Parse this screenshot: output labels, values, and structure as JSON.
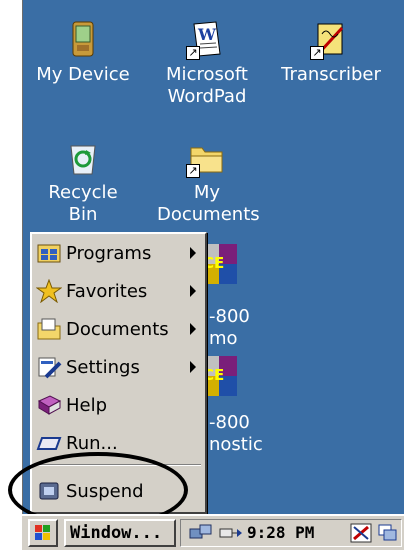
{
  "desktop": {
    "icons": [
      {
        "label": "My Device"
      },
      {
        "label": "Microsoft WordPad"
      },
      {
        "label": "Transcriber"
      },
      {
        "label": "Recycle Bin"
      },
      {
        "label": "My Documents"
      }
    ],
    "partial_labels": {
      "app1_line1": "-800",
      "app1_line2": "mo",
      "app2_line1": "-800",
      "app2_line2": "nostic",
      "wce_text": "CE"
    }
  },
  "start_menu": {
    "items": [
      {
        "label": "Programs",
        "submenu": true
      },
      {
        "label": "Favorites",
        "submenu": true
      },
      {
        "label": "Documents",
        "submenu": true
      },
      {
        "label": "Settings",
        "submenu": true
      },
      {
        "label": "Help",
        "submenu": false
      },
      {
        "label": "Run...",
        "submenu": false
      },
      {
        "label": "Suspend",
        "submenu": false
      }
    ]
  },
  "taskbar": {
    "task_button_label": "Window...",
    "clock": "9:28 PM"
  },
  "colors": {
    "desktop": "#3a6ea5",
    "menu": "#d4d0c8",
    "highlight_ring": "#000000"
  }
}
